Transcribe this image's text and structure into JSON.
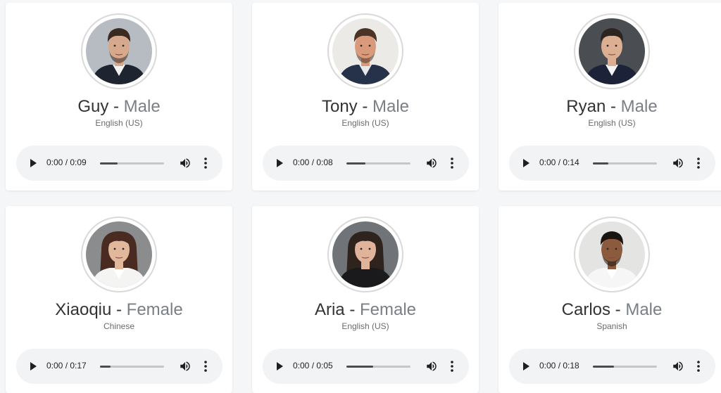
{
  "separator": " - ",
  "voices": [
    {
      "name": "Guy",
      "gender": "Male",
      "language": "English (US)",
      "time": "0:00 / 0:09",
      "progress": 0.28,
      "avatar": {
        "bg": "#b7bcc2",
        "skin": "#d7a98c",
        "hair": "#3a2a20",
        "shirt": "#1e2530",
        "collar": "#f2f2f2",
        "beard": true
      }
    },
    {
      "name": "Tony",
      "gender": "Male",
      "language": "English (US)",
      "time": "0:00 / 0:08",
      "progress": 0.3,
      "avatar": {
        "bg": "#eceae6",
        "skin": "#d89a7a",
        "hair": "#4a3426",
        "shirt": "#25324a",
        "collar": "#e8e8e8",
        "beard": true
      }
    },
    {
      "name": "Ryan",
      "gender": "Male",
      "language": "English (US)",
      "time": "0:00 / 0:14",
      "progress": 0.24,
      "avatar": {
        "bg": "#4a4d52",
        "skin": "#dcae92",
        "hair": "#2c241e",
        "shirt": "#1c2338",
        "collar": "#f5f5f5",
        "beard": false
      }
    },
    {
      "name": "Xiaoqiu",
      "gender": "Female",
      "language": "Chinese",
      "time": "0:00 / 0:17",
      "progress": 0.17,
      "avatar": {
        "bg": "#8a8c8e",
        "skin": "#e2b89c",
        "hair": "#4a2b22",
        "shirt": "#f4f4f2",
        "collar": "#ffffff",
        "beard": false
      }
    },
    {
      "name": "Aria",
      "gender": "Female",
      "language": "English (US)",
      "time": "0:00 / 0:05",
      "progress": 0.42,
      "avatar": {
        "bg": "#707478",
        "skin": "#e0b39b",
        "hair": "#2e231d",
        "shirt": "#1a1a1c",
        "collar": "#1a1a1c",
        "beard": false
      }
    },
    {
      "name": "Carlos",
      "gender": "Male",
      "language": "Spanish",
      "time": "0:00 / 0:18",
      "progress": 0.33,
      "avatar": {
        "bg": "#e4e5e3",
        "skin": "#8c5a3c",
        "hair": "#1a1410",
        "shirt": "#f6f6f6",
        "collar": "#ffffff",
        "beard": true
      }
    }
  ]
}
